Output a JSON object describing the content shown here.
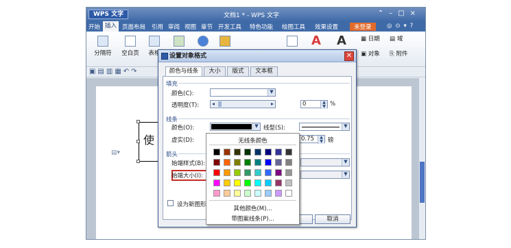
{
  "app": {
    "name": "WPS 文字",
    "doc_title": "文档1 * - WPS 文字",
    "login": "未登录"
  },
  "menu": [
    "开始",
    "插入",
    "页面布局",
    "引用",
    "审阅",
    "视图",
    "章节",
    "开发工具",
    "特色功能",
    "绘图工具",
    "效果设置"
  ],
  "ribbon": {
    "separator": "分隔符",
    "blank_page": "空白页",
    "table": "表格",
    "date": "日期",
    "field": "域",
    "object": "对象",
    "attachment": "附件"
  },
  "document": {
    "shape_text": "使"
  },
  "dialog": {
    "title": "设置对象格式",
    "tabs": [
      "颜色与线条",
      "大小",
      "版式",
      "文本框"
    ],
    "fill_section": "填充",
    "fill_color_label": "颜色(C):",
    "transparency_label": "透明度(T):",
    "transparency_value": "0",
    "transparency_unit": "%",
    "line_section": "线条",
    "line_color_label": "颜色(O):",
    "line_color": "#000000",
    "line_style_label": "线型(S):",
    "dash_label": "虚实(D):",
    "weight_value": "0.75",
    "weight_unit": "磅",
    "arrows_section": "箭头",
    "begin_style_label": "始端样式(B):",
    "begin_size_label": "始端大小(I):",
    "default_checkbox": "设为新图形默",
    "cancel_button": "取消"
  },
  "palette": {
    "no_line": "无线条颜色",
    "more_colors": "其他颜色(M)...",
    "pattern_line": "带图案线条(P)...",
    "colors": [
      [
        "#000000",
        "#993300",
        "#333300",
        "#003300",
        "#003366",
        "#000080",
        "#333399",
        "#333333"
      ],
      [
        "#800000",
        "#ff6600",
        "#808000",
        "#008000",
        "#008080",
        "#0000ff",
        "#666699",
        "#808080"
      ],
      [
        "#ff0000",
        "#ff9900",
        "#99cc00",
        "#339966",
        "#33cccc",
        "#3366ff",
        "#800080",
        "#969696"
      ],
      [
        "#ff00ff",
        "#ffcc00",
        "#ffff00",
        "#00ff00",
        "#00ffff",
        "#00ccff",
        "#993366",
        "#c0c0c0"
      ],
      [
        "#ff99cc",
        "#ffcc99",
        "#ffff99",
        "#ccffcc",
        "#ccffff",
        "#99ccff",
        "#cc99ff",
        "#ffffff"
      ]
    ]
  }
}
